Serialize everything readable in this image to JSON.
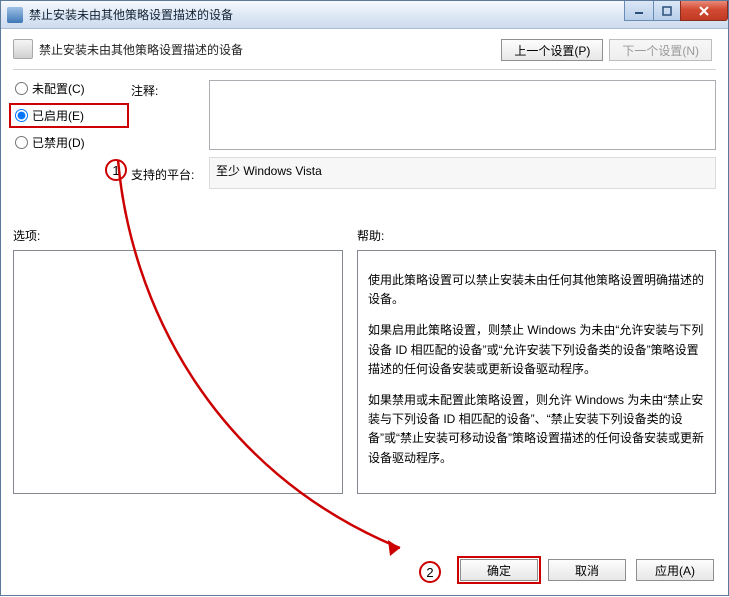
{
  "window": {
    "title": "禁止安装未由其他策略设置描述的设备"
  },
  "header": {
    "policy_title": "禁止安装未由其他策略设置描述的设备",
    "prev_setting": "上一个设置(P)",
    "next_setting": "下一个设置(N)"
  },
  "radios": {
    "not_configured": "未配置(C)",
    "enabled": "已启用(E)",
    "disabled": "已禁用(D)"
  },
  "labels": {
    "note": "注释:",
    "supported_on": "支持的平台:",
    "options": "选项:",
    "help": "帮助:"
  },
  "values": {
    "note_text": "",
    "supported_on_text": "至少 Windows Vista"
  },
  "help": {
    "p1": "使用此策略设置可以禁止安装未由任何其他策略设置明确描述的设备。",
    "p2": "如果启用此策略设置，则禁止 Windows 为未由“允许安装与下列设备 ID 相匹配的设备”或“允许安装下列设备类的设备”策略设置描述的任何设备安装或更新设备驱动程序。",
    "p3": "如果禁用或未配置此策略设置，则允许 Windows 为未由“禁止安装与下列设备 ID 相匹配的设备”、“禁止安装下列设备类的设备”或“禁止安装可移动设备”策略设置描述的任何设备安装或更新设备驱动程序。"
  },
  "footer": {
    "ok": "确定",
    "cancel": "取消",
    "apply": "应用(A)"
  },
  "annotations": {
    "n1": "1",
    "n2": "2"
  }
}
